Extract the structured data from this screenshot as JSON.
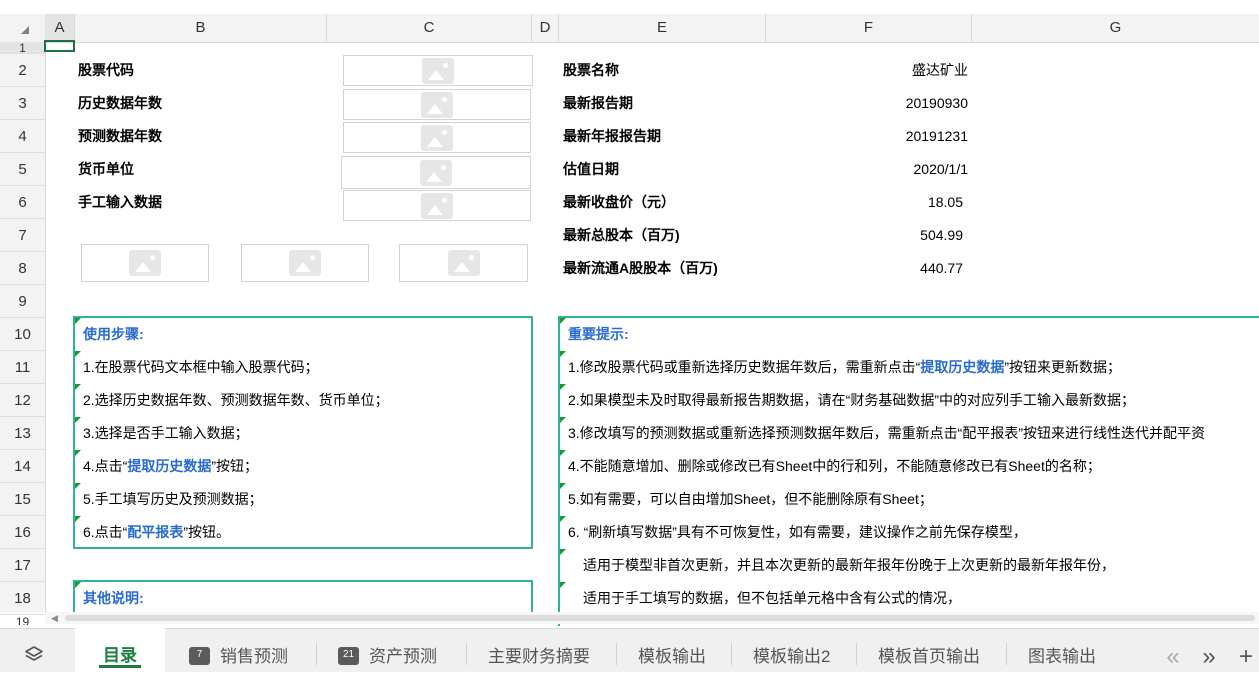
{
  "columns": [
    "A",
    "B",
    "C",
    "D",
    "E",
    "F",
    "G"
  ],
  "rows": [
    "1",
    "2",
    "3",
    "4",
    "5",
    "6",
    "7",
    "8",
    "9",
    "10",
    "11",
    "12",
    "13",
    "14",
    "15",
    "16",
    "17",
    "18",
    "19"
  ],
  "left_labels": [
    "股票代码",
    "历史数据年数",
    "预测数据年数",
    "货币单位",
    "手工输入数据"
  ],
  "info": [
    {
      "label": "股票名称",
      "value": "盛达矿业"
    },
    {
      "label": "最新报告期",
      "value": "20190930"
    },
    {
      "label": "最新年报报告期",
      "value": "20191231"
    },
    {
      "label": "估值日期",
      "value": "2020/1/1"
    },
    {
      "label": "最新收盘价（元）",
      "value": "18.05"
    },
    {
      "label": "最新总股本（百万)",
      "value": "504.99"
    },
    {
      "label": "最新流通A股股本（百万)",
      "value": "440.77"
    }
  ],
  "steps": {
    "title": "使用步骤:",
    "s1": "1.在股票代码文本框中输入股票代码；",
    "s2": "2.选择历史数据年数、预测数据年数、货币单位；",
    "s3": "3.选择是否手工输入数据；",
    "s4_pre": "4.点击“",
    "s4_link": "提取历史数据",
    "s4_post": "”按钮；",
    "s5": "5.手工填写历史及预测数据；",
    "s6_pre": "6.点击“",
    "s6_link": "配平报表",
    "s6_post": "”按钮。"
  },
  "notes": {
    "title": "重要提示:",
    "n1_pre": "1.修改股票代码或重新选择历史数据年数后，需重新点击“",
    "n1_link": "提取历史数据",
    "n1_post": "”按钮来更新数据；",
    "n2": "2.如果模型未及时取得最新报告期数据，请在“财务基础数据”中的对应列手工输入最新数据；",
    "n3": "3.修改填写的预测数据或重新选择预测数据年数后，需重新点击“配平报表”按钮来进行线性迭代并配平资",
    "n4": "4.不能随意增加、删除或修改已有Sheet中的行和列，不能随意修改已有Sheet的名称；",
    "n5": "5.如有需要，可以自由增加Sheet，但不能删除原有Sheet；",
    "n6": "6. “刷新填写数据”具有不可恢复性，如有需要，建议操作之前先保存模型，",
    "n7": "适用于模型非首次更新，并且本次更新的最新年报年份晚于上次更新的最新年报年份，",
    "n8": "适用于手工填写的数据，但不包括单元格中含有公式的情况，"
  },
  "other": {
    "title": "其他说明:"
  },
  "tabs": [
    {
      "label": "目录"
    },
    {
      "label": "销售预测",
      "badge": "7"
    },
    {
      "label": "资产预测",
      "badge": "21"
    },
    {
      "label": "主要财务摘要"
    },
    {
      "label": "模板输出"
    },
    {
      "label": "模板输出2"
    },
    {
      "label": "模板首页输出"
    },
    {
      "label": "图表输出"
    }
  ],
  "tabnav": {
    "prev": "«",
    "next": "»",
    "add": "+"
  },
  "icons": {
    "sheets": "layers-icon",
    "corner": "select-all-icon"
  },
  "colors": {
    "accent": "#2db39d",
    "link": "#2a6bd1",
    "active_tab": "#1a7f3c"
  }
}
